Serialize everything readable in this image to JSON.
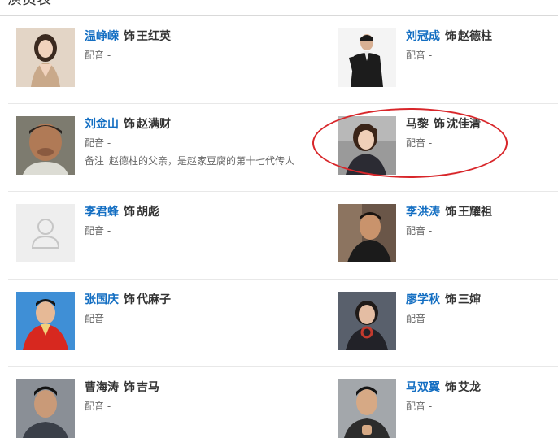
{
  "section": {
    "title": "演员表"
  },
  "role_word": "饰",
  "voice_label": "配音",
  "voice_value": "-",
  "note_label": "备注",
  "annotation": {
    "color": "#d8262a"
  },
  "cast": [
    {
      "actor": "温峥嵘",
      "role": "王红英",
      "linked": true,
      "voice": "-"
    },
    {
      "actor": "刘冠成",
      "role": "赵德柱",
      "linked": true,
      "voice": "-"
    },
    {
      "actor": "刘金山",
      "role": "赵满财",
      "linked": true,
      "voice": "-",
      "note": "赵德柱的父亲，是赵家豆腐的第十七代传人"
    },
    {
      "actor": "马黎",
      "role": "沈佳清",
      "linked": false,
      "voice": "-",
      "circled": true
    },
    {
      "actor": "李君蜂",
      "role": "胡彪",
      "linked": true,
      "voice": "-",
      "placeholder_photo": true
    },
    {
      "actor": "李洪涛",
      "role": "王耀祖",
      "linked": true,
      "voice": "-"
    },
    {
      "actor": "张国庆",
      "role": "代麻子",
      "linked": true,
      "voice": "-"
    },
    {
      "actor": "廖学秋",
      "role": "三婶",
      "linked": true,
      "voice": "-"
    },
    {
      "actor": "曹海涛",
      "role": "吉马",
      "linked": false,
      "voice": "-"
    },
    {
      "actor": "马双翼",
      "role": "艾龙",
      "linked": true,
      "voice": "-"
    }
  ]
}
